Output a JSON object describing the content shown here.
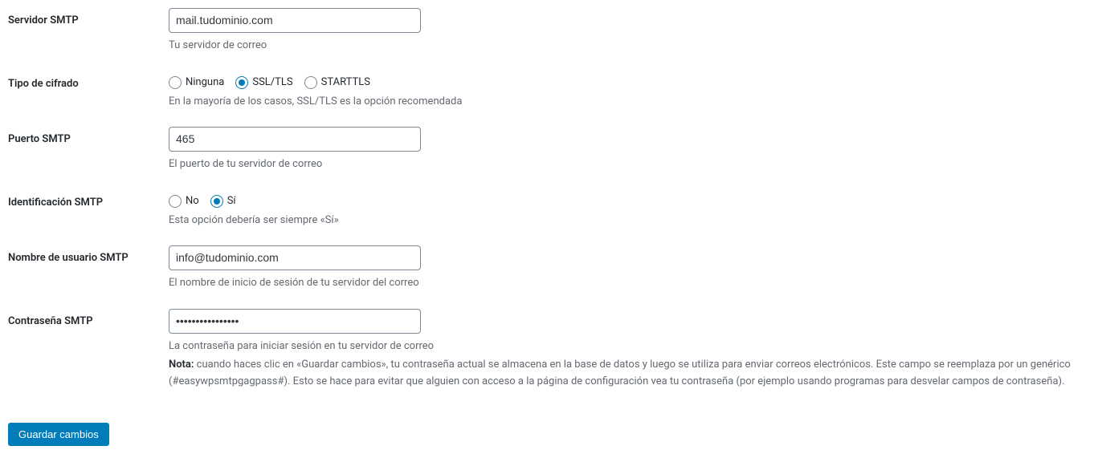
{
  "fields": {
    "smtp_server": {
      "label": "Servidor SMTP",
      "value": "mail.tudominio.com",
      "description": "Tu servidor de correo"
    },
    "encryption": {
      "label": "Tipo de cifrado",
      "options": {
        "none": "Ninguna",
        "ssltls": "SSL/TLS",
        "starttls": "STARTTLS"
      },
      "selected": "ssltls",
      "description": "En la mayoría de los casos, SSL/TLS es la opción recomendada"
    },
    "smtp_port": {
      "label": "Puerto SMTP",
      "value": "465",
      "description": "El puerto de tu servidor de correo"
    },
    "smtp_auth": {
      "label": "Identificación SMTP",
      "options": {
        "no": "No",
        "yes": "Sí"
      },
      "selected": "yes",
      "description": "Esta opción debería ser siempre «Sí»"
    },
    "smtp_username": {
      "label": "Nombre de usuario SMTP",
      "value": "info@tudominio.com",
      "description": "El nombre de inicio de sesión de tu servidor del correo"
    },
    "smtp_password": {
      "label": "Contraseña SMTP",
      "value": "••••••••••••••••",
      "description": "La contraseña para iniciar sesión en tu servidor de correo",
      "note_label": "Nota:",
      "note": " cuando haces clic en «Guardar cambios», tu contraseña actual se almacena en la base de datos y luego se utiliza para enviar correos electrónicos. Este campo se reemplaza por un genérico (#easywpsmtpgagpass#). Esto se hace para evitar que alguien con acceso a la página de configuración vea tu contraseña (por ejemplo usando programas para desvelar campos de contraseña)."
    }
  },
  "buttons": {
    "save": "Guardar cambios"
  }
}
